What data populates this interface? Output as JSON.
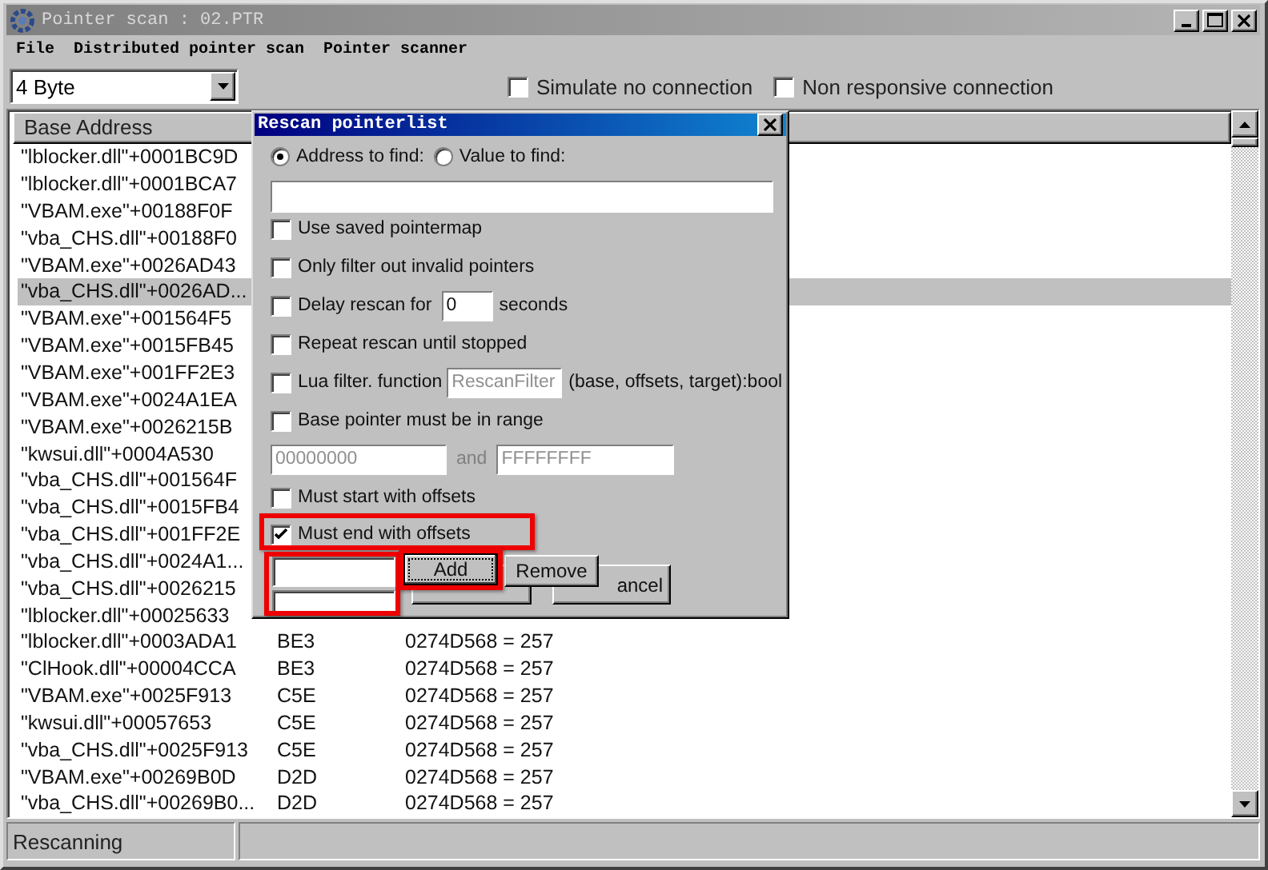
{
  "window": {
    "title": "Pointer scan : 02.PTR"
  },
  "menu": [
    "File",
    "Distributed pointer scan",
    "Pointer scanner"
  ],
  "toolbar": {
    "value_type": "4 Byte",
    "options": [
      {
        "label": "Simulate no connection",
        "checked": false
      },
      {
        "label": "Non responsive connection",
        "checked": false
      }
    ]
  },
  "table": {
    "columns": [
      "Base Address"
    ],
    "rows": [
      {
        "cells": [
          "\"lblocker.dll\"+0001BC9D"
        ],
        "selected": false
      },
      {
        "cells": [
          "\"lblocker.dll\"+0001BCA7"
        ],
        "selected": false
      },
      {
        "cells": [
          "\"VBAM.exe\"+00188F0F"
        ],
        "selected": false
      },
      {
        "cells": [
          "\"vba_CHS.dll\"+00188F0"
        ],
        "selected": false
      },
      {
        "cells": [
          "\"VBAM.exe\"+0026AD43"
        ],
        "selected": false
      },
      {
        "cells": [
          "\"vba_CHS.dll\"+0026AD..."
        ],
        "selected": true
      },
      {
        "cells": [
          "\"VBAM.exe\"+001564F5"
        ],
        "selected": false
      },
      {
        "cells": [
          "\"VBAM.exe\"+0015FB45"
        ],
        "selected": false
      },
      {
        "cells": [
          "\"VBAM.exe\"+001FF2E3"
        ],
        "selected": false
      },
      {
        "cells": [
          "\"VBAM.exe\"+0024A1EA"
        ],
        "selected": false
      },
      {
        "cells": [
          "\"VBAM.exe\"+0026215B"
        ],
        "selected": false
      },
      {
        "cells": [
          "\"kwsui.dll\"+0004A530"
        ],
        "selected": false
      },
      {
        "cells": [
          "\"vba_CHS.dll\"+001564F"
        ],
        "selected": false
      },
      {
        "cells": [
          "\"vba_CHS.dll\"+0015FB4"
        ],
        "selected": false
      },
      {
        "cells": [
          "\"vba_CHS.dll\"+001FF2E"
        ],
        "selected": false
      },
      {
        "cells": [
          "\"vba_CHS.dll\"+0024A1..."
        ],
        "selected": false
      },
      {
        "cells": [
          "\"vba_CHS.dll\"+0026215"
        ],
        "selected": false
      },
      {
        "cells": [
          "\"lblocker.dll\"+00025633"
        ],
        "selected": false
      },
      {
        "cells": [
          "\"lblocker.dll\"+0003ADA1",
          "BE3",
          "0274D568 = 257"
        ],
        "selected": false
      },
      {
        "cells": [
          "\"ClHook.dll\"+00004CCA",
          "BE3",
          "0274D568 = 257"
        ],
        "selected": false
      },
      {
        "cells": [
          "\"VBAM.exe\"+0025F913",
          "C5E",
          "0274D568 = 257"
        ],
        "selected": false
      },
      {
        "cells": [
          "\"kwsui.dll\"+00057653",
          "C5E",
          "0274D568 = 257"
        ],
        "selected": false
      },
      {
        "cells": [
          "\"vba_CHS.dll\"+0025F913",
          "C5E",
          "0274D568 = 257"
        ],
        "selected": false
      },
      {
        "cells": [
          "\"VBAM.exe\"+00269B0D",
          "D2D",
          "0274D568 = 257"
        ],
        "selected": false
      },
      {
        "cells": [
          "\"vba_CHS.dll\"+00269B0...",
          "D2D",
          "0274D568 = 257"
        ],
        "selected": false
      }
    ]
  },
  "status_bar": {
    "text": "Rescanning"
  },
  "dialog": {
    "title": "Rescan pointerlist",
    "find_mode": [
      {
        "label": "Address to find:",
        "selected": true
      },
      {
        "label": "Value to find:",
        "selected": false
      }
    ],
    "options": [
      {
        "kind": "checkbox",
        "label": "Use saved pointermap",
        "checked": false,
        "highlighted": false
      },
      {
        "kind": "checkbox",
        "label": "Only filter out invalid pointers",
        "checked": false,
        "highlighted": false
      },
      {
        "kind": "delay",
        "label": "Delay rescan for",
        "checked": false,
        "highlighted": false,
        "value": "0",
        "unit": "seconds"
      },
      {
        "kind": "checkbox",
        "label": "Repeat rescan until stopped",
        "checked": false,
        "highlighted": false
      },
      {
        "kind": "lua",
        "label": "Lua filter. function",
        "checked": false,
        "highlighted": false,
        "value": "RescanFilter",
        "suffix": "(base, offsets, target):bool"
      },
      {
        "kind": "checkbox",
        "label": "Base pointer must be in range",
        "checked": false,
        "highlighted": false
      },
      {
        "kind": "range",
        "from": "00000000",
        "joiner": "and",
        "to": "FFFFFFFF"
      },
      {
        "kind": "checkbox",
        "label": "Must start with offsets",
        "checked": false,
        "highlighted": false
      },
      {
        "kind": "checkbox",
        "label": "Must end with offsets",
        "checked": true,
        "highlighted": true
      }
    ],
    "offset_fields": {
      "highlighted": true
    },
    "buttons": [
      {
        "label": "Add",
        "focused": true,
        "highlighted": true
      },
      {
        "label": "Remove",
        "focused": false,
        "highlighted": false
      }
    ],
    "covered_button": {
      "label": "ancel"
    }
  }
}
